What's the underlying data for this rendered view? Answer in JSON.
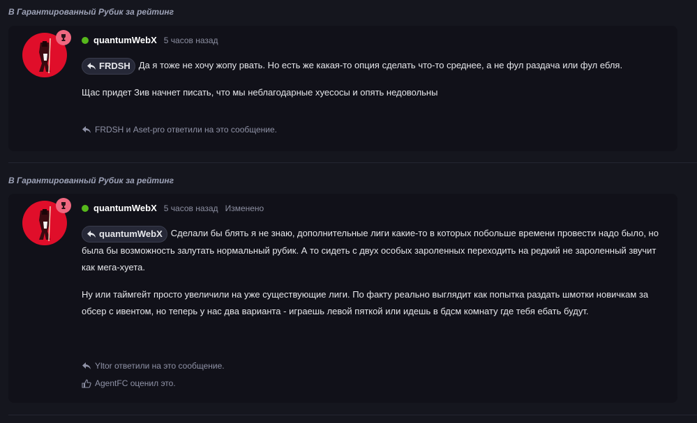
{
  "posts": [
    {
      "context": "В Гарантированный Рубик за рейтинг",
      "author": "quantumWebX",
      "time": "5 часов назад",
      "edited": "",
      "quote_user": "FRDSH",
      "para1": "Да я тоже не хочу жопу рвать. Но есть же какая-то опция сделать что-то среднее, а не фул раздача или фул ебля.",
      "para2": "Щас придет Зив начнет писать, что мы неблагодарные хуесосы и опять недовольны",
      "replies": "FRDSH и Aset-pro ответили на это сообщение.",
      "likes": ""
    },
    {
      "context": "В Гарантированный Рубик за рейтинг",
      "author": "quantumWebX",
      "time": "5 часов назад",
      "edited": "Изменено",
      "quote_user": "quantumWebX",
      "para1": "Сделали бы блять я не знаю, дополнительные лиги какие-то в которых побольше времени провести надо было, но была бы возможность залутать нормальный рубик. А то сидеть с двух особых зароленных переходить на редкий не зароленный звучит как мега-хуета.",
      "para2": "Ну или таймгейт просто увеличили на уже существующие лиги. По факту реально выглядит как попытка раздать шмотки новичкам за обсер с ивентом, но теперь у нас два варианта - играешь левой пяткой или идешь в бдсм комнату где тебя ебать будут.",
      "replies": "Yltor ответили на это сообщение.",
      "likes": "AgentFC оценил это."
    }
  ],
  "colors": {
    "background": "#15161e",
    "card": "#111119",
    "online": "#57b81c",
    "avatar": "#e00e2a",
    "badge": "#ef6880"
  }
}
